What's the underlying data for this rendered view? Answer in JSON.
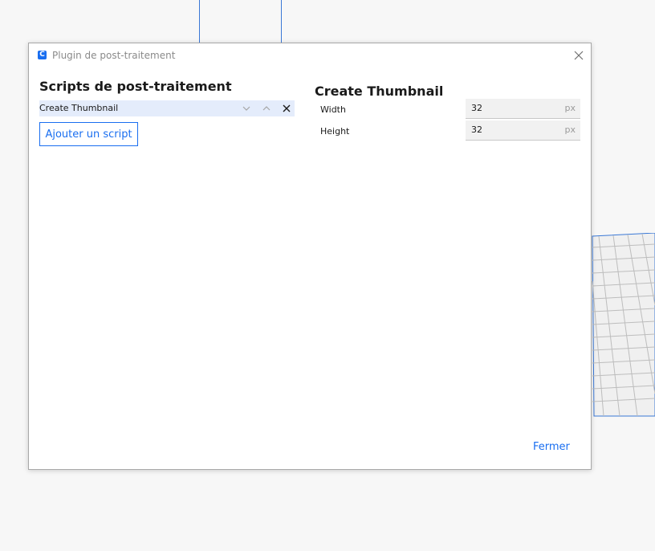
{
  "window": {
    "title": "Plugin de post-traitement",
    "app_icon_letter": "C",
    "icons": {
      "app": "cura-logo-icon",
      "close": "close-icon"
    }
  },
  "scripts_panel": {
    "heading": "Scripts de post-traitement",
    "scripts": [
      {
        "label": "Create Thumbnail",
        "selected": true,
        "actions": [
          "chevron-down-icon",
          "chevron-up-icon",
          "remove-x-icon"
        ]
      }
    ],
    "add_button_label": "Ajouter un script"
  },
  "settings_panel": {
    "heading": "Create Thumbnail",
    "settings": [
      {
        "label": "Width",
        "value": "32",
        "unit": "px"
      },
      {
        "label": "Height",
        "value": "32",
        "unit": "px"
      }
    ]
  },
  "footer": {
    "close_label": "Fermer"
  },
  "colors": {
    "accent": "#196ef0",
    "selected_row": "#e4ecfb",
    "field_bg": "#f1f1f1",
    "background": "#f7f7f7"
  }
}
